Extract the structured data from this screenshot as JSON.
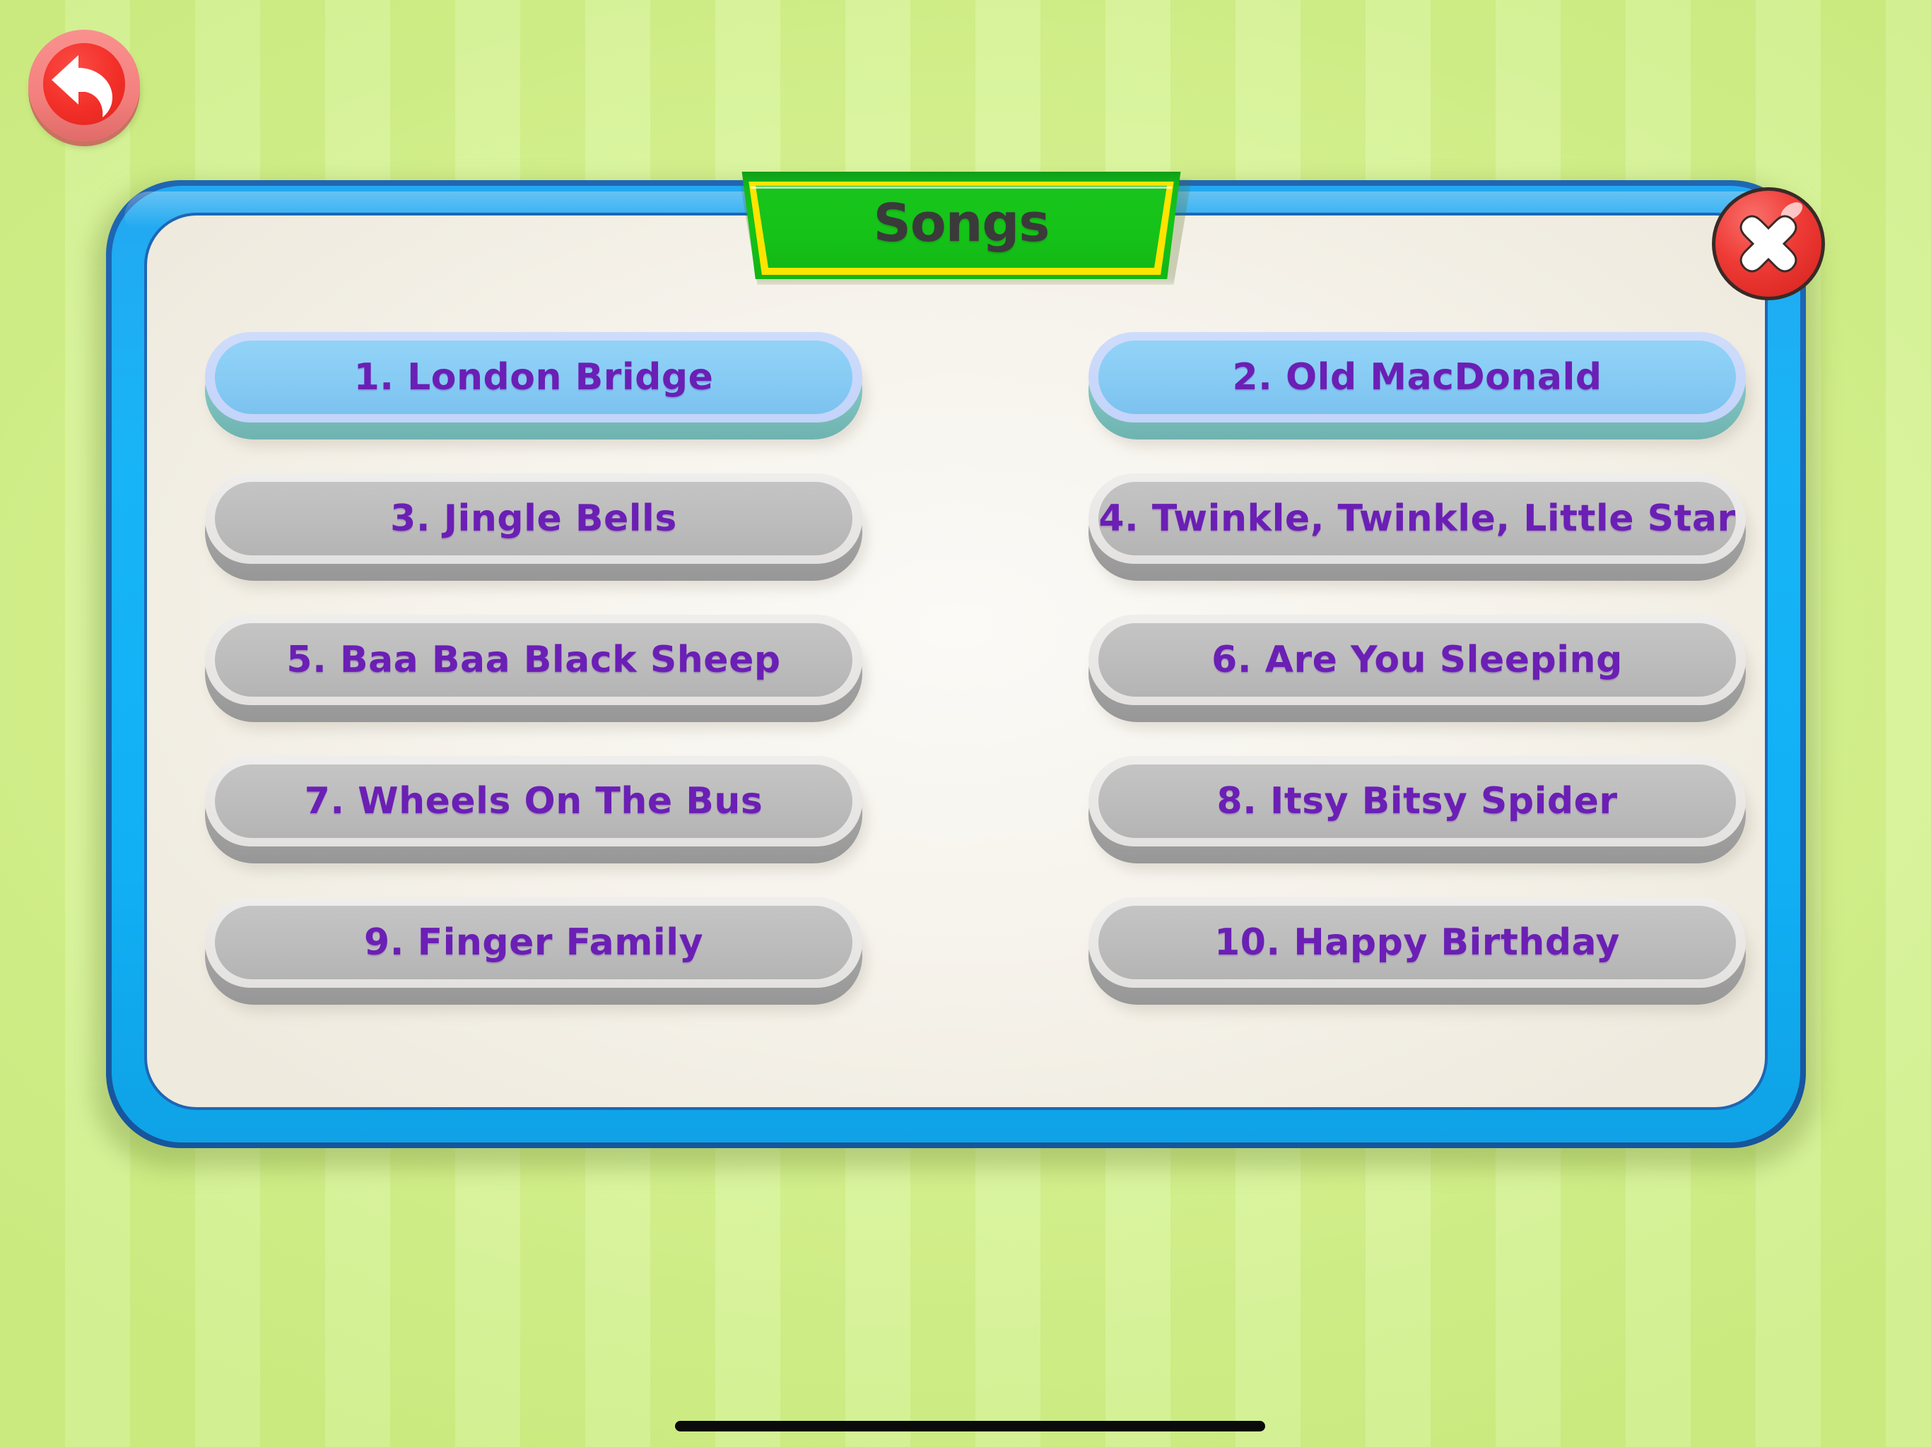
{
  "background": {
    "stripe_color_light": "#d9f59a",
    "stripe_color_dark": "#cfee83"
  },
  "nav": {
    "back_button": {
      "icon": "back-arrow-icon",
      "color": "#f02e2e"
    }
  },
  "panel": {
    "title": "Songs",
    "title_text_color": "#3a3a3a",
    "banner_color": "#14c517",
    "banner_border_color": "#ffe400",
    "border_color": "#11b0f5",
    "body_color": "#f8f6f0",
    "close_button": {
      "icon": "close-icon",
      "color": "#ef3b36"
    }
  },
  "songs": [
    {
      "label": "1. London Bridge",
      "state": "selected"
    },
    {
      "label": "2. Old MacDonald",
      "state": "selected"
    },
    {
      "label": "3. Jingle Bells",
      "state": "plain"
    },
    {
      "label": "4. Twinkle, Twinkle, Little Star",
      "state": "plain"
    },
    {
      "label": "5. Baa Baa Black Sheep",
      "state": "plain"
    },
    {
      "label": "6. Are You Sleeping",
      "state": "plain"
    },
    {
      "label": "7. Wheels On The Bus",
      "state": "plain"
    },
    {
      "label": "8. Itsy Bitsy Spider",
      "state": "plain"
    },
    {
      "label": "9. Finger Family",
      "state": "plain"
    },
    {
      "label": "10. Happy Birthday",
      "state": "plain"
    }
  ],
  "song_label_color": "#6b1fb5",
  "home_indicator": {
    "color": "#0a0a0a"
  }
}
